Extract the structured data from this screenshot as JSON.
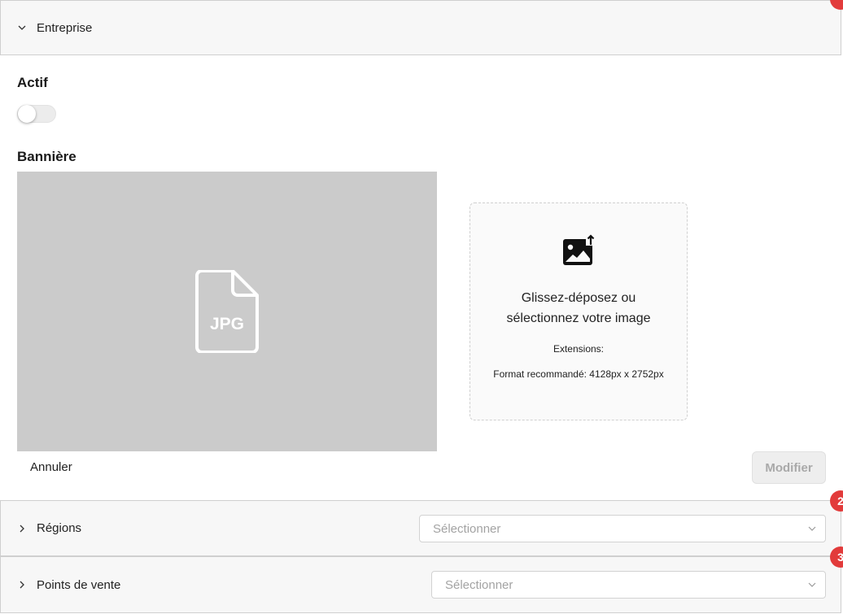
{
  "sections": {
    "entreprise": {
      "title": "Entreprise"
    },
    "regions": {
      "title": "Régions",
      "badge": "2",
      "placeholder": "Sélectionner"
    },
    "points_de_vente": {
      "title": "Points de vente",
      "badge": "3",
      "placeholder": "Sélectionner"
    }
  },
  "actif": {
    "label": "Actif",
    "enabled": false
  },
  "banniere": {
    "label": "Bannière",
    "preview_icon": "jpg-file-icon",
    "preview_text": "JPG",
    "dropzone": {
      "icon": "image-upload-icon",
      "main_line1": "Glissez-déposez ou",
      "main_line2": "sélectionnez votre image",
      "extensions": "Extensions:",
      "format": "Format recommandé: 4128px x 2752px"
    }
  },
  "actions": {
    "cancel": "Annuler",
    "modify": "Modifier"
  },
  "colors": {
    "badge": "#e23b3b",
    "preview_bg": "#cbcbcb",
    "header_bg": "#f7f7f7"
  }
}
